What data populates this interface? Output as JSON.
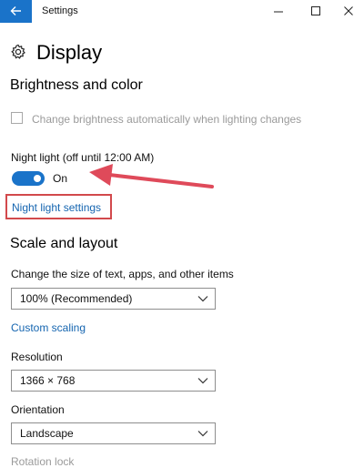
{
  "window": {
    "title": "Settings"
  },
  "icons": {
    "back": "back-arrow-icon",
    "minimize": "minimize-icon",
    "maximize": "maximize-icon",
    "close": "close-icon",
    "page": "gear-icon",
    "dropdown": "chevron-down-icon"
  },
  "page": {
    "title": "Display"
  },
  "brightness": {
    "heading": "Brightness and color",
    "auto_brightness": {
      "label": "Change brightness automatically when lighting changes",
      "checked": false
    }
  },
  "night_light": {
    "label": "Night light (off until 12:00 AM)",
    "toggle_state": "On",
    "settings_link": "Night light settings"
  },
  "scale": {
    "heading": "Scale and layout",
    "size_label": "Change the size of text, apps, and other items",
    "size_value": "100% (Recommended)",
    "custom_scaling_link": "Custom scaling",
    "resolution_label": "Resolution",
    "resolution_value": "1366 × 768",
    "orientation_label": "Orientation",
    "orientation_value": "Landscape",
    "rotation_lock_label": "Rotation lock"
  },
  "colors": {
    "accent": "#1a73c9",
    "link": "#1565b0",
    "highlight": "#d2494c",
    "disabled": "#9a9a9a"
  }
}
